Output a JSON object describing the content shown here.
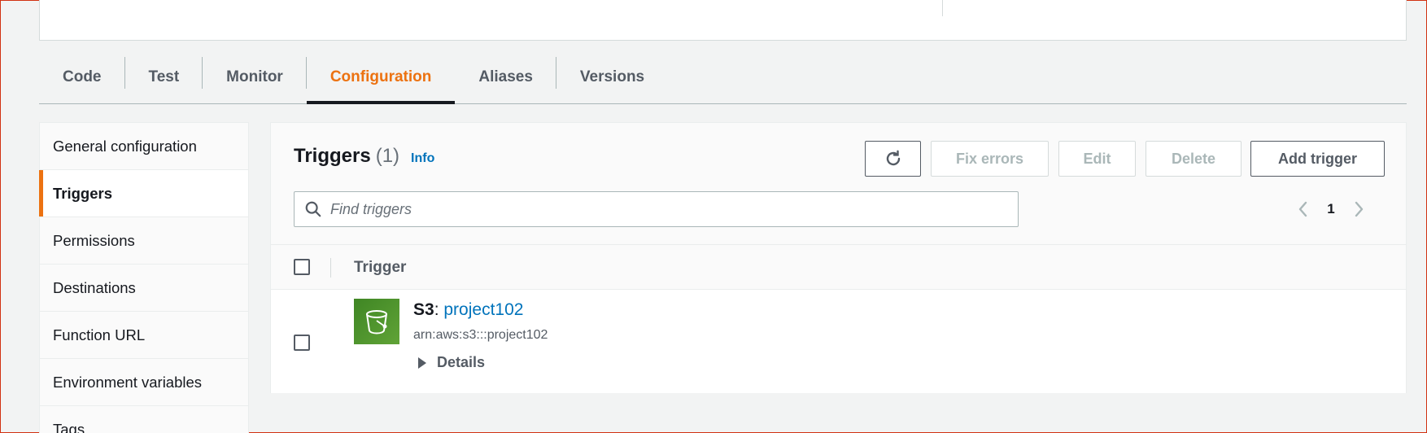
{
  "tabs": [
    {
      "label": "Code"
    },
    {
      "label": "Test"
    },
    {
      "label": "Monitor"
    },
    {
      "label": "Configuration",
      "active": true
    },
    {
      "label": "Aliases"
    },
    {
      "label": "Versions"
    }
  ],
  "sidebar": {
    "items": [
      {
        "label": "General configuration"
      },
      {
        "label": "Triggers",
        "active": true
      },
      {
        "label": "Permissions"
      },
      {
        "label": "Destinations"
      },
      {
        "label": "Function URL"
      },
      {
        "label": "Environment variables"
      },
      {
        "label": "Tags"
      }
    ]
  },
  "triggers": {
    "title": "Triggers",
    "count": "(1)",
    "info_link": "Info",
    "buttons": {
      "fix_errors": "Fix errors",
      "edit": "Edit",
      "delete": "Delete",
      "add": "Add trigger"
    },
    "search_placeholder": "Find triggers",
    "page": "1",
    "column_header": "Trigger",
    "rows": [
      {
        "service": "S3",
        "separator": ":",
        "name": "project102",
        "arn": "arn:aws:s3:::project102",
        "details_label": "Details",
        "icon": "s3-bucket-icon"
      }
    ]
  },
  "colors": {
    "accent": "#ec7211",
    "link": "#0073bb",
    "s3_green": "#3f8624"
  }
}
